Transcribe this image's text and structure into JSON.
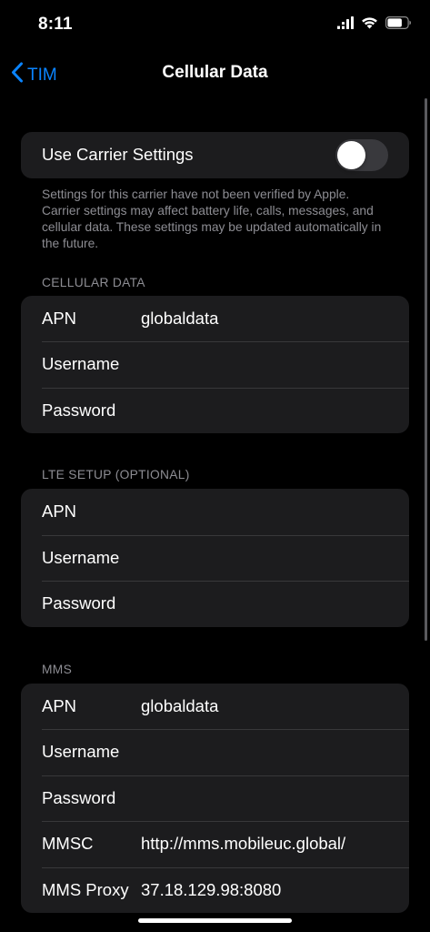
{
  "status_bar": {
    "time": "8:11"
  },
  "nav": {
    "back_label": "TIM",
    "title": "Cellular Data"
  },
  "carrier": {
    "toggle_label": "Use Carrier Settings",
    "toggle_on": false,
    "footnote": "Settings for this carrier have not been verified by Apple. Carrier settings may affect battery life, calls, messages, and cellular data. These settings may be updated automatically in the future."
  },
  "cellular_data": {
    "header": "CELLULAR DATA",
    "rows": [
      {
        "label": "APN",
        "value": "globaldata"
      },
      {
        "label": "Username",
        "value": ""
      },
      {
        "label": "Password",
        "value": ""
      }
    ]
  },
  "lte_setup": {
    "header": "LTE SETUP (OPTIONAL)",
    "rows": [
      {
        "label": "APN",
        "value": ""
      },
      {
        "label": "Username",
        "value": ""
      },
      {
        "label": "Password",
        "value": ""
      }
    ]
  },
  "mms": {
    "header": "MMS",
    "rows": [
      {
        "label": "APN",
        "value": "globaldata"
      },
      {
        "label": "Username",
        "value": ""
      },
      {
        "label": "Password",
        "value": ""
      },
      {
        "label": "MMSC",
        "value": "http://mms.mobileuc.global/"
      },
      {
        "label": "MMS Proxy",
        "value": "37.18.129.98:8080"
      }
    ]
  },
  "colors": {
    "accent": "#0a84ff",
    "group_bg": "#1c1c1e",
    "background": "#000000",
    "secondary_text": "#8d8d93"
  },
  "icons": [
    "chevron-left-icon",
    "signal-icon",
    "wifi-icon",
    "battery-icon"
  ]
}
